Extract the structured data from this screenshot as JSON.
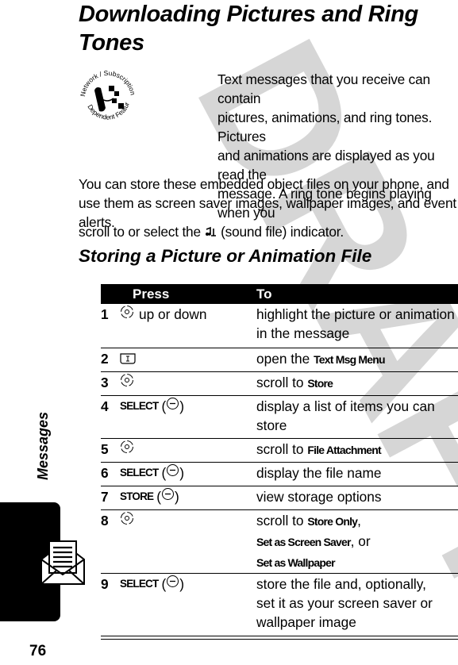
{
  "watermark": "DRAFT",
  "page": {
    "title": "Downloading Pictures and Ring Tones",
    "feature_badge": {
      "icon": "network-subscription-feature-icon",
      "top_text": "Network / Subscription",
      "bottom_text": "Dependent Feature"
    },
    "paragraph1": {
      "lines": [
        "Text messages that you receive can contain",
        "pictures, animations, and ring tones. Pictures",
        "and animations are displayed as you read the",
        "message. A ring tone begins playing when you"
      ],
      "last_line_before": "scroll to or select the",
      "sound_icon": "sound-file-icon",
      "last_line_after": "(sound file) indicator."
    },
    "paragraph2": "You can store these embedded object files on your phone, and use them as screen saver images, wallpaper images, and event alerts.",
    "section_title": "Storing a Picture or Animation File",
    "table": {
      "headers": {
        "press": "Press",
        "to": "To"
      },
      "rows": [
        {
          "num": "1",
          "press_icon": "nav-key-icon",
          "press_text": "up or down",
          "to": "highlight the picture or animation in the message"
        },
        {
          "num": "2",
          "press_icon": "menu-key-icon",
          "press_text": "",
          "to_prefix": "open the",
          "to_keyword": "Text Msg Menu"
        },
        {
          "num": "3",
          "press_icon": "nav-key-icon",
          "press_text": "",
          "to_prefix": "scroll to",
          "to_keyword": "Store"
        },
        {
          "num": "4",
          "press_softkey": "SELECT",
          "press_icon": "left-soft-key-icon",
          "to": "display a list of items you can store"
        },
        {
          "num": "5",
          "press_icon": "nav-key-icon",
          "press_text": "",
          "to_prefix": "scroll to",
          "to_keyword": "File Attachment"
        },
        {
          "num": "6",
          "press_softkey": "SELECT",
          "press_icon": "left-soft-key-icon",
          "to": "display the file name"
        },
        {
          "num": "7",
          "press_softkey": "STORE",
          "press_icon": "left-soft-key-icon",
          "to": "view storage options"
        },
        {
          "num": "8",
          "press_icon": "nav-key-icon",
          "press_text": "",
          "to_prefix": "scroll to",
          "to_keyword1": "Store Only",
          "to_keyword2": "Set as Screen Saver",
          "to_or": "or",
          "to_keyword3": "Set as Wallpaper"
        },
        {
          "num": "9",
          "press_softkey": "SELECT",
          "press_icon": "left-soft-key-icon",
          "to_lines": [
            "store the file and, optionally,",
            "set it as your screen saver or",
            "wallpaper image"
          ]
        }
      ]
    }
  },
  "sidebar": {
    "section_label": "Messages",
    "tab_icon": "envelope-message-icon",
    "page_number": "76"
  }
}
